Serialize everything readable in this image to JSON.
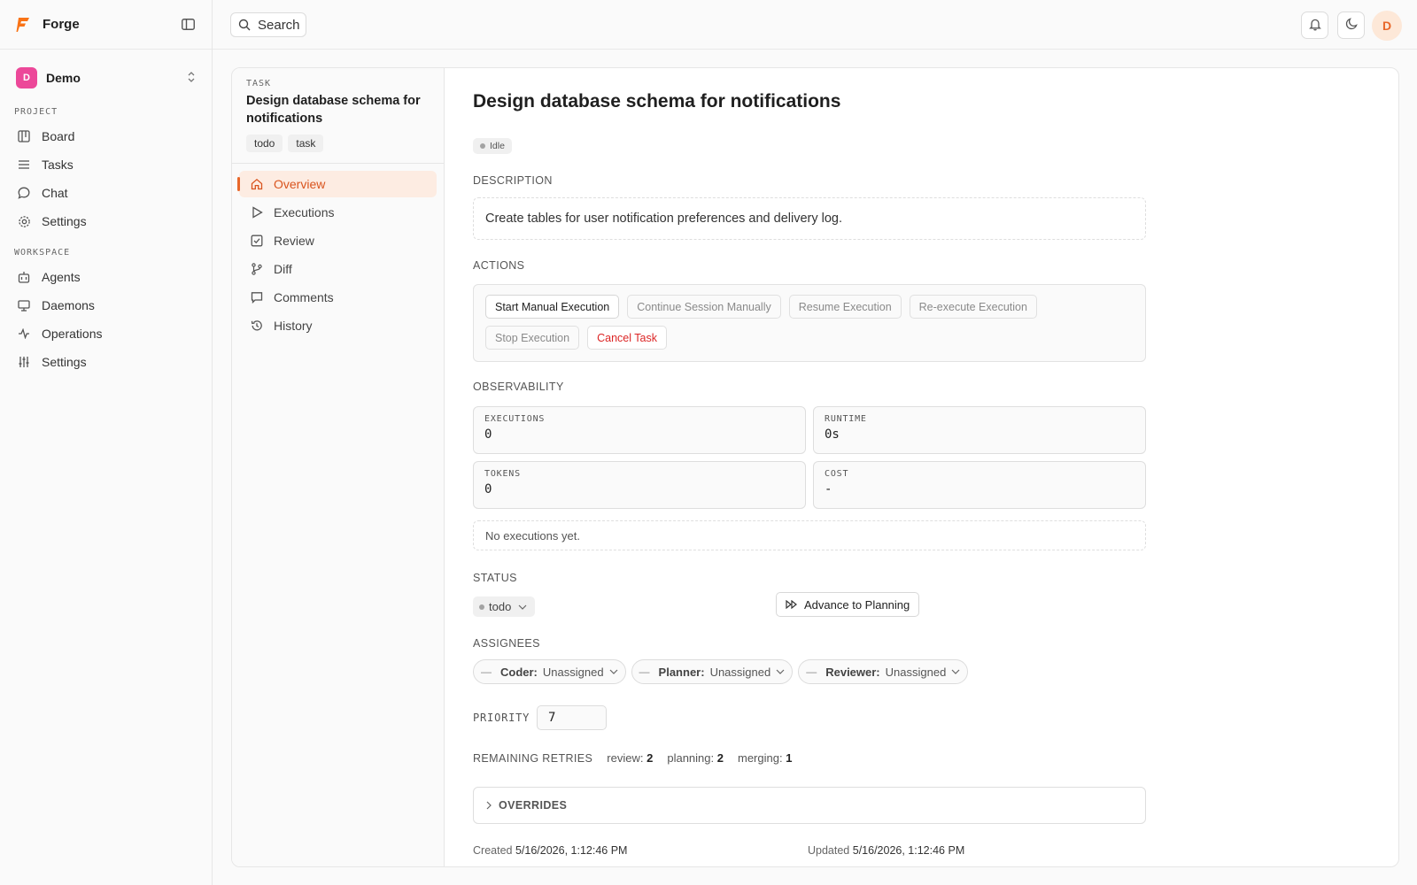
{
  "app": {
    "name": "Forge"
  },
  "org": {
    "initial": "D",
    "name": "Demo"
  },
  "sidebar": {
    "project_label": "PROJECT",
    "project_items": [
      {
        "label": "Board",
        "icon": "board-icon"
      },
      {
        "label": "Tasks",
        "icon": "list-icon"
      },
      {
        "label": "Chat",
        "icon": "chat-icon"
      },
      {
        "label": "Settings",
        "icon": "gear-icon"
      }
    ],
    "workspace_label": "WORKSPACE",
    "workspace_items": [
      {
        "label": "Agents",
        "icon": "bot-icon"
      },
      {
        "label": "Daemons",
        "icon": "monitor-icon"
      },
      {
        "label": "Operations",
        "icon": "activity-icon"
      },
      {
        "label": "Settings",
        "icon": "sliders-icon"
      }
    ]
  },
  "topbar": {
    "search_label": "Search",
    "user_initial": "D"
  },
  "task": {
    "kicker": "TASK",
    "title": "Design database schema for notifications",
    "tags": [
      "todo",
      "task"
    ]
  },
  "subnav": [
    {
      "label": "Overview",
      "icon": "home-icon",
      "active": true
    },
    {
      "label": "Executions",
      "icon": "play-icon"
    },
    {
      "label": "Review",
      "icon": "check-square-icon"
    },
    {
      "label": "Diff",
      "icon": "git-branch-icon"
    },
    {
      "label": "Comments",
      "icon": "comment-icon"
    },
    {
      "label": "History",
      "icon": "history-icon"
    }
  ],
  "main": {
    "title": "Design database schema for notifications",
    "state": "Idle",
    "description_heading": "DESCRIPTION",
    "description": "Create tables for user notification preferences and delivery log.",
    "actions_heading": "ACTIONS",
    "actions": {
      "start": "Start Manual Execution",
      "continue": "Continue Session Manually",
      "resume": "Resume Execution",
      "reexecute": "Re-execute Execution",
      "stop": "Stop Execution",
      "cancel": "Cancel Task"
    },
    "observability_heading": "OBSERVABILITY",
    "observability": {
      "executions_label": "EXECUTIONS",
      "executions": "0",
      "runtime_label": "RUNTIME",
      "runtime": "0s",
      "tokens_label": "TOKENS",
      "tokens": "0",
      "cost_label": "COST",
      "cost": "-"
    },
    "no_executions": "No executions yet.",
    "status_heading": "STATUS",
    "status_value": "todo",
    "advance_label": "Advance to Planning",
    "assignees_heading": "ASSIGNEES",
    "assignees": [
      {
        "role": "Coder:",
        "value": "Unassigned"
      },
      {
        "role": "Planner:",
        "value": "Unassigned"
      },
      {
        "role": "Reviewer:",
        "value": "Unassigned"
      }
    ],
    "priority_label": "PRIORITY",
    "priority_value": "7",
    "retries_label": "REMAINING RETRIES",
    "retries": {
      "review_label": "review:",
      "review": "2",
      "planning_label": "planning:",
      "planning": "2",
      "merging_label": "merging:",
      "merging": "1"
    },
    "overrides_label": "OVERRIDES",
    "created_label": "Created",
    "created_value": "5/16/2026, 1:12:46 PM",
    "updated_label": "Updated",
    "updated_value": "5/16/2026, 1:12:46 PM"
  },
  "colors": {
    "accent": "#e8672a",
    "danger": "#dc2626",
    "org_avatar": "#ec4899"
  }
}
